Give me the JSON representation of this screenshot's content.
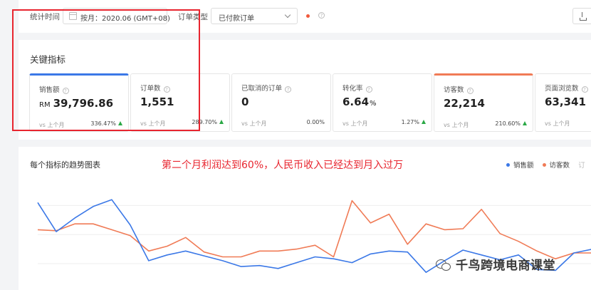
{
  "filters": {
    "period_label": "统计时间",
    "period_value": "按月：2020.06 (GMT+08)",
    "order_type_label": "订单类型",
    "order_type_value": "已付款订单"
  },
  "metrics": {
    "section_title": "关键指标",
    "compare_text": "vs 上个月",
    "cards": [
      {
        "label": "销售额",
        "prefix": "RM",
        "value": "39,796.86",
        "suffix": "",
        "change": "336.47%",
        "trend": "up"
      },
      {
        "label": "订单数",
        "prefix": "",
        "value": "1,551",
        "suffix": "",
        "change": "289.70%",
        "trend": "up"
      },
      {
        "label": "已取消的订单",
        "prefix": "",
        "value": "0",
        "suffix": "",
        "change": "0.00%",
        "trend": "none"
      },
      {
        "label": "转化率",
        "prefix": "",
        "value": "6.64",
        "suffix": "%",
        "change": "1.27%",
        "trend": "up"
      },
      {
        "label": "访客数",
        "prefix": "",
        "value": "22,214",
        "suffix": "",
        "change": "210.60%",
        "trend": "up"
      },
      {
        "label": "页面浏览数",
        "prefix": "",
        "value": "63,341",
        "suffix": "",
        "change": "",
        "trend": "none"
      }
    ]
  },
  "trend": {
    "title": "每个指标的趋势图表",
    "annotation": "第二个月利润达到60%，人民币收入已经达到月入过万",
    "legend": [
      "销售额",
      "访客数",
      "订"
    ]
  },
  "watermark": {
    "text": "千鸟跨境电商课堂"
  },
  "colors": {
    "sales": "#3b78e7",
    "visitors": "#f07b56",
    "annotation": "#e8252f",
    "up": "#2aa845"
  },
  "chart_data": {
    "type": "line",
    "title": "",
    "xlabel": "",
    "ylabel": "",
    "ylim": [
      0,
      100
    ],
    "grid": true,
    "legend_position": "top-right",
    "x": [
      1,
      2,
      3,
      4,
      5,
      6,
      7,
      8,
      9,
      10,
      11,
      12,
      13,
      14,
      15,
      16,
      17,
      18,
      19,
      20,
      21,
      22,
      23,
      24,
      25,
      26,
      27,
      28,
      29,
      30,
      31
    ],
    "series": [
      {
        "name": "销售额",
        "color": "#3b78e7",
        "values": [
          88,
          58,
          72,
          84,
          91,
          65,
          28,
          34,
          38,
          33,
          28,
          22,
          23,
          20,
          26,
          32,
          30,
          26,
          35,
          38,
          37,
          16,
          28,
          39,
          34,
          29,
          34,
          19,
          18,
          36,
          40
        ]
      },
      {
        "name": "访客数",
        "color": "#f07b56",
        "values": [
          60,
          59,
          66,
          66,
          60,
          54,
          38,
          43,
          52,
          37,
          32,
          32,
          38,
          38,
          40,
          44,
          32,
          90,
          67,
          76,
          45,
          66,
          60,
          61,
          81,
          56,
          48,
          38,
          30,
          36,
          36
        ]
      }
    ]
  }
}
